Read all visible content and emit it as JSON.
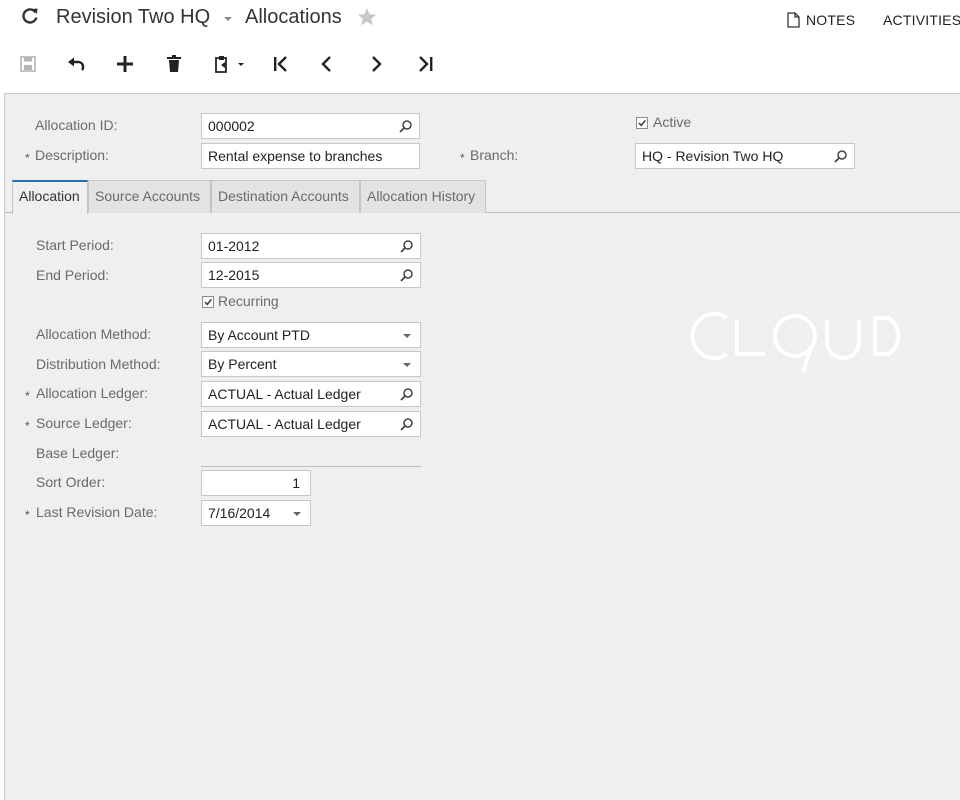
{
  "header": {
    "company": "Revision Two HQ",
    "screen_title": "Allocations",
    "notes_label": "NOTES",
    "activities_label": "ACTIVITIES"
  },
  "toolbar": {
    "icons": [
      "save-icon",
      "undo-icon",
      "add-icon",
      "delete-icon",
      "clipboard-icon",
      "first-record-icon",
      "previous-record-icon",
      "next-record-icon",
      "last-record-icon"
    ]
  },
  "form": {
    "allocation_id": {
      "label": "Allocation ID:",
      "value": "000002"
    },
    "description": {
      "label": "Description:",
      "value": "Rental expense to branches"
    },
    "active": {
      "label": "Active",
      "checked": true
    },
    "branch": {
      "label": "Branch:",
      "value": "HQ - Revision Two HQ"
    }
  },
  "tabs": [
    {
      "label": "Allocation",
      "active": true
    },
    {
      "label": "Source Accounts",
      "active": false
    },
    {
      "label": "Destination Accounts",
      "active": false
    },
    {
      "label": "Allocation History",
      "active": false
    }
  ],
  "allocation_tab": {
    "start_period": {
      "label": "Start Period:",
      "value": "01-2012"
    },
    "end_period": {
      "label": "End Period:",
      "value": "12-2015"
    },
    "recurring": {
      "label": "Recurring",
      "checked": true
    },
    "allocation_method": {
      "label": "Allocation Method:",
      "value": "By Account PTD"
    },
    "distribution_method": {
      "label": "Distribution Method:",
      "value": "By Percent"
    },
    "allocation_ledger": {
      "label": "Allocation Ledger:",
      "value": "ACTUAL - Actual Ledger"
    },
    "source_ledger": {
      "label": "Source Ledger:",
      "value": "ACTUAL - Actual Ledger"
    },
    "base_ledger": {
      "label": "Base Ledger:",
      "value": ""
    },
    "sort_order": {
      "label": "Sort Order:",
      "value": "1"
    },
    "last_revision_date": {
      "label": "Last Revision Date:",
      "value": "7/16/2014"
    }
  },
  "required_marker": "*",
  "watermark": {
    "text": "CLOUD",
    "color": "#ffffff"
  }
}
